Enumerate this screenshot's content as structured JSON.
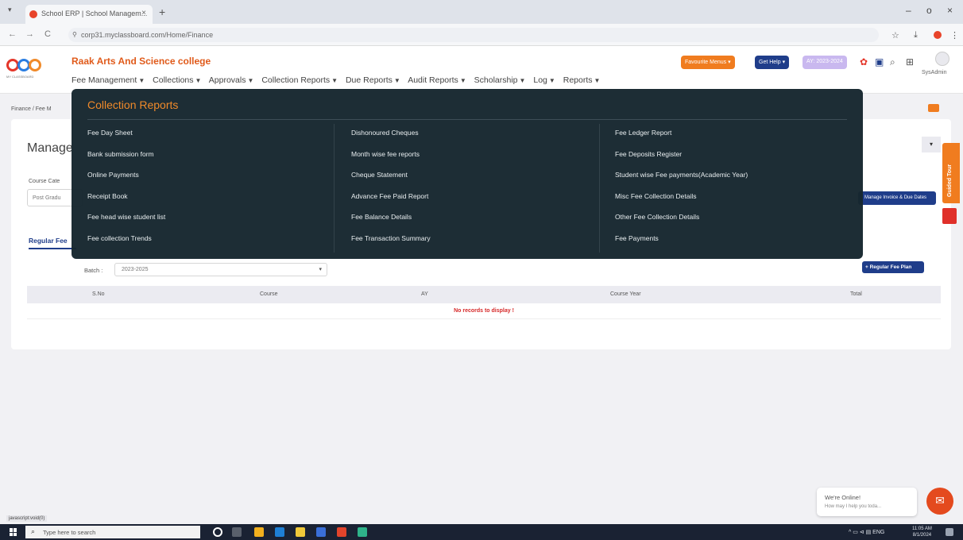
{
  "browser": {
    "tab_title": "School ERP | School Managem...",
    "tab_close": "×",
    "new_tab": "+",
    "url": "corp31.myclassboard.com/Home/Finance",
    "window_controls": [
      "–",
      "o",
      "×"
    ]
  },
  "app": {
    "college_name": "Raak Arts And Science college",
    "logo_caption": "MY CLASSBOARD",
    "menu": [
      "Fee Management",
      "Collections",
      "Approvals",
      "Collection Reports",
      "Due Reports",
      "Audit Reports",
      "Scholarship",
      "Log",
      "Reports"
    ],
    "favourite_menus_label": "Favourite Menus",
    "get_help_label": "Get Help",
    "academic_year_label": "AY: 2023-2024",
    "user": "SysAdmin",
    "colors": {
      "accent": "#f08a2a",
      "brand_blue": "#1f3d8a",
      "brand_orange": "#e05a1a",
      "error": "#d62828"
    }
  },
  "page": {
    "breadcrumb": "Finance / Fee M",
    "title": "Manage",
    "course_category_label": "Course Cate",
    "course_category_value": "Post Gradu",
    "invoice_button": "Manage Invoice & Due Dates",
    "tab_regular_fee": "Regular Fee",
    "batch_label": "Batch :",
    "batch_value": "2023-2025",
    "regular_fee_plan_button": "+ Regular Fee Plan",
    "table_headers": [
      "S.No",
      "Course",
      "AY",
      "Course Year",
      "Total"
    ],
    "no_records": "No records to display !"
  },
  "dropdown": {
    "title": "Collection Reports",
    "columns": [
      [
        "Fee Day Sheet",
        "Bank submission form",
        "Online Payments",
        "Receipt Book",
        "Fee head wise student list",
        "Fee collection Trends"
      ],
      [
        "Dishonoured Cheques",
        "Month wise fee reports",
        "Cheque Statement",
        "Advance Fee Paid Report",
        "Fee Balance Details",
        "Fee Transaction Summary"
      ],
      [
        "Fee Ledger Report",
        "Fee Deposits Register",
        "Student wise Fee payments(Academic Year)",
        "Misc Fee Collection Details",
        "Other Fee Collection Details",
        "Fee Payments"
      ]
    ]
  },
  "widgets": {
    "guided_tour": "Guided Tour",
    "chat_line1": "We're Online!",
    "chat_line2": "How may I help you toda...",
    "status_url": "javascript:void(0)"
  },
  "taskbar": {
    "search_placeholder": "Type here to search",
    "tray_lang": "ENG",
    "time": "11:05 AM",
    "date": "8/1/2024"
  }
}
